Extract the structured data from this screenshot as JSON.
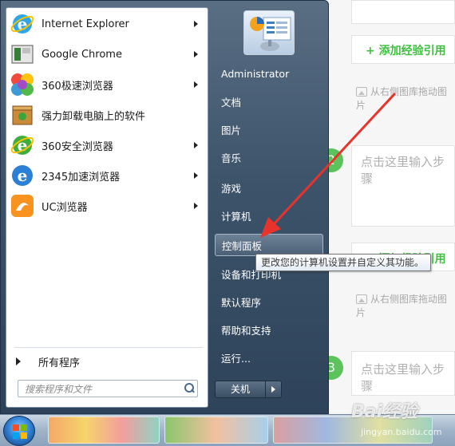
{
  "background": {
    "add_experience_link": "+ 添加经验引用",
    "drag_image_hint": "从右侧图库拖动图片",
    "step_input_placeholder": "点击这里输入步骤",
    "step_numbers": [
      "2",
      "3"
    ]
  },
  "start_menu": {
    "programs": [
      {
        "label": "Internet Explorer",
        "has_submenu": true,
        "icon": "ie-icon"
      },
      {
        "label": "Google Chrome",
        "has_submenu": true,
        "icon": "chrome-icon"
      },
      {
        "label": "360极速浏览器",
        "has_submenu": true,
        "icon": "360-speed-browser-icon"
      },
      {
        "label": "强力卸载电脑上的软件",
        "has_submenu": false,
        "icon": "uninstall-icon"
      },
      {
        "label": "360安全浏览器",
        "has_submenu": true,
        "icon": "360-safe-browser-icon"
      },
      {
        "label": "2345加速浏览器",
        "has_submenu": true,
        "icon": "2345-browser-icon"
      },
      {
        "label": "UC浏览器",
        "has_submenu": true,
        "icon": "uc-browser-icon"
      }
    ],
    "all_programs": "所有程序",
    "search_placeholder": "搜索程序和文件",
    "right_items": [
      "Administrator",
      "文档",
      "图片",
      "音乐",
      "游戏",
      "计算机",
      "控制面板",
      "设备和打印机",
      "默认程序",
      "帮助和支持",
      "运行..."
    ],
    "highlighted_item": "控制面板",
    "shutdown_label": "关机",
    "tooltip": "更改您的计算机设置并自定义其功能。"
  },
  "watermark": {
    "brand": "Bai经验",
    "url": "jingyan.baidu.com"
  },
  "colors": {
    "accent_green": "#3fbf3f",
    "arrow_red": "#e8322c",
    "menu_dark": "#2e4359"
  }
}
